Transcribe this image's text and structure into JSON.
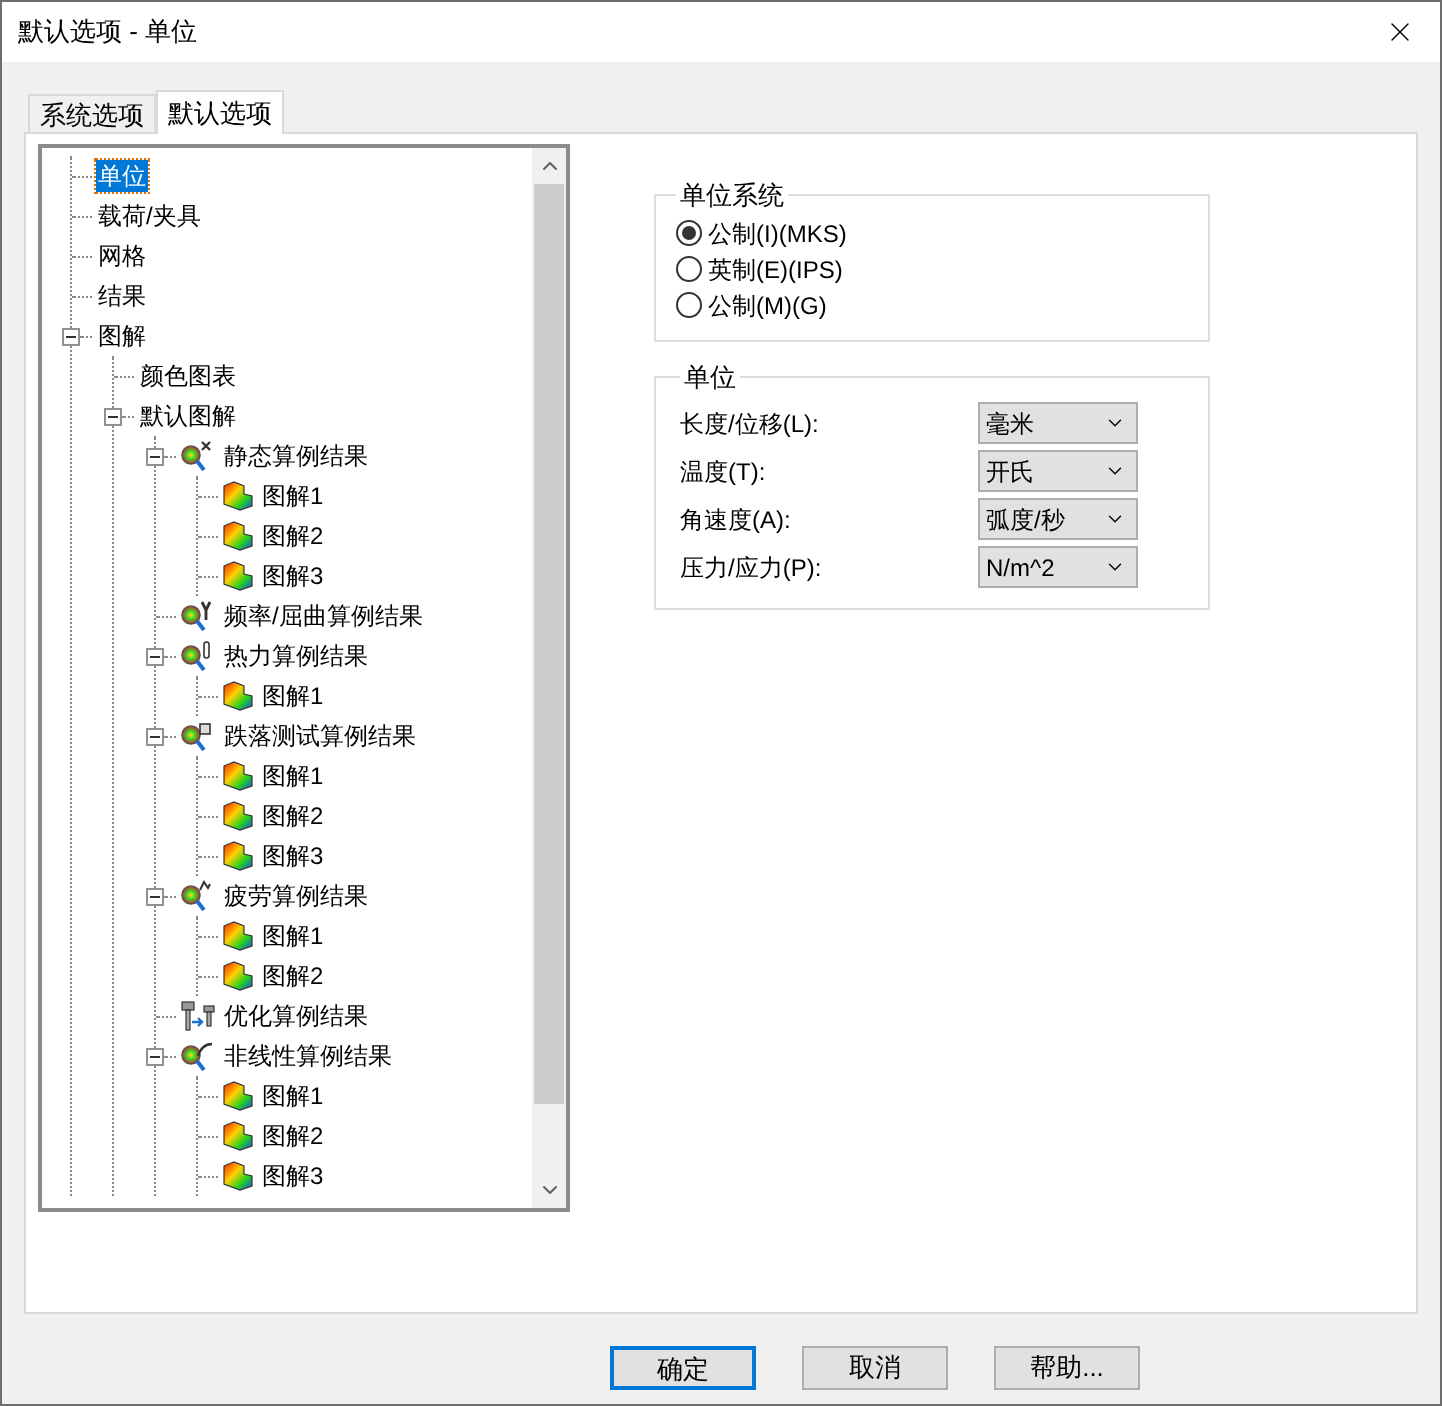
{
  "window": {
    "title": "默认选项 - 单位"
  },
  "tabs": [
    {
      "label": "系统选项",
      "selected": false
    },
    {
      "label": "默认选项",
      "selected": true
    }
  ],
  "tree": [
    {
      "label": "单位",
      "kind": "item",
      "selected": true
    },
    {
      "label": "载荷/夹具",
      "kind": "item",
      "selected": false
    },
    {
      "label": "网格",
      "kind": "item",
      "selected": false
    },
    {
      "label": "结果",
      "kind": "item",
      "selected": false
    },
    {
      "label": "图解",
      "kind": "item",
      "selected": false,
      "expanded": true,
      "children": [
        {
          "label": "颜色图表",
          "kind": "item",
          "selected": false
        },
        {
          "label": "默认图解",
          "kind": "item",
          "selected": false,
          "expanded": true,
          "children": [
            {
              "label": "静态算例结果",
              "kind": "static",
              "selected": false,
              "expanded": true,
              "children": [
                {
                  "label": "图解1",
                  "kind": "plot",
                  "selected": false
                },
                {
                  "label": "图解2",
                  "kind": "plot",
                  "selected": false
                },
                {
                  "label": "图解3",
                  "kind": "plot",
                  "selected": false
                }
              ]
            },
            {
              "label": "频率/屈曲算例结果",
              "kind": "frequency",
              "selected": false
            },
            {
              "label": "热力算例结果",
              "kind": "thermal",
              "selected": false,
              "expanded": true,
              "children": [
                {
                  "label": "图解1",
                  "kind": "plot",
                  "selected": false
                }
              ]
            },
            {
              "label": "跌落测试算例结果",
              "kind": "drop",
              "selected": false,
              "expanded": true,
              "children": [
                {
                  "label": "图解1",
                  "kind": "plot",
                  "selected": false
                },
                {
                  "label": "图解2",
                  "kind": "plot",
                  "selected": false
                },
                {
                  "label": "图解3",
                  "kind": "plot",
                  "selected": false
                }
              ]
            },
            {
              "label": "疲劳算例结果",
              "kind": "fatigue",
              "selected": false,
              "expanded": true,
              "children": [
                {
                  "label": "图解1",
                  "kind": "plot",
                  "selected": false
                },
                {
                  "label": "图解2",
                  "kind": "plot",
                  "selected": false
                }
              ]
            },
            {
              "label": "优化算例结果",
              "kind": "optimization",
              "selected": false
            },
            {
              "label": "非线性算例结果",
              "kind": "nonlinear",
              "selected": false,
              "expanded": true,
              "children": [
                {
                  "label": "图解1",
                  "kind": "plot",
                  "selected": false
                },
                {
                  "label": "图解2",
                  "kind": "plot",
                  "selected": false
                },
                {
                  "label": "图解3",
                  "kind": "plot",
                  "selected": false
                }
              ]
            }
          ]
        }
      ]
    }
  ],
  "unit_system": {
    "title": "单位系统",
    "options": [
      {
        "label": "公制(I)(MKS)",
        "selected": true
      },
      {
        "label": "英制(E)(IPS)",
        "selected": false
      },
      {
        "label": "公制(M)(G)",
        "selected": false
      }
    ]
  },
  "units": {
    "title": "单位",
    "fields": [
      {
        "label": "长度/位移(L):",
        "value": "毫米"
      },
      {
        "label": "温度(T):",
        "value": "开氏"
      },
      {
        "label": "角速度(A):",
        "value": "弧度/秒"
      },
      {
        "label": "压力/应力(P):",
        "value": "N/m^2"
      }
    ]
  },
  "buttons": [
    {
      "label": "确定",
      "default": true
    },
    {
      "label": "取消",
      "default": false
    },
    {
      "label": "帮助...",
      "default": false
    }
  ]
}
